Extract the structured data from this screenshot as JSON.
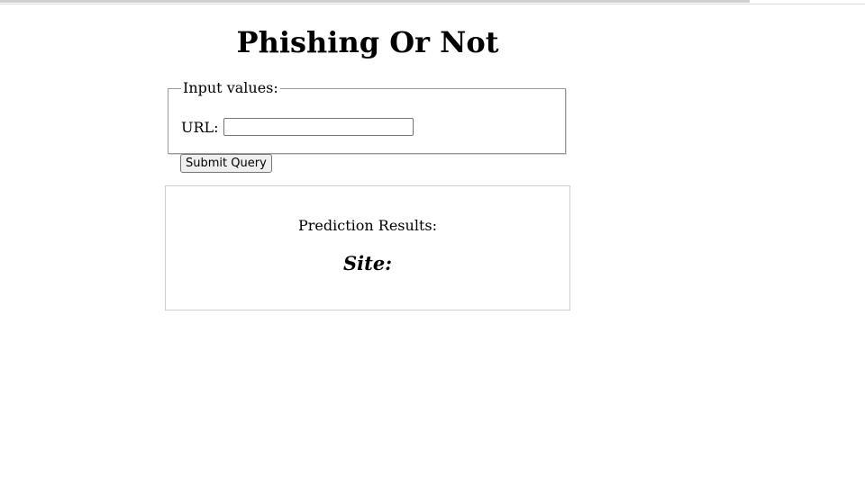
{
  "page": {
    "title": "Phishing Or Not"
  },
  "form": {
    "legend": "Input values:",
    "url_label": "URL:",
    "url_value": "",
    "url_placeholder": "",
    "submit_label": "Submit Query"
  },
  "results": {
    "heading": "Prediction Results:",
    "site_label": "Site:"
  }
}
